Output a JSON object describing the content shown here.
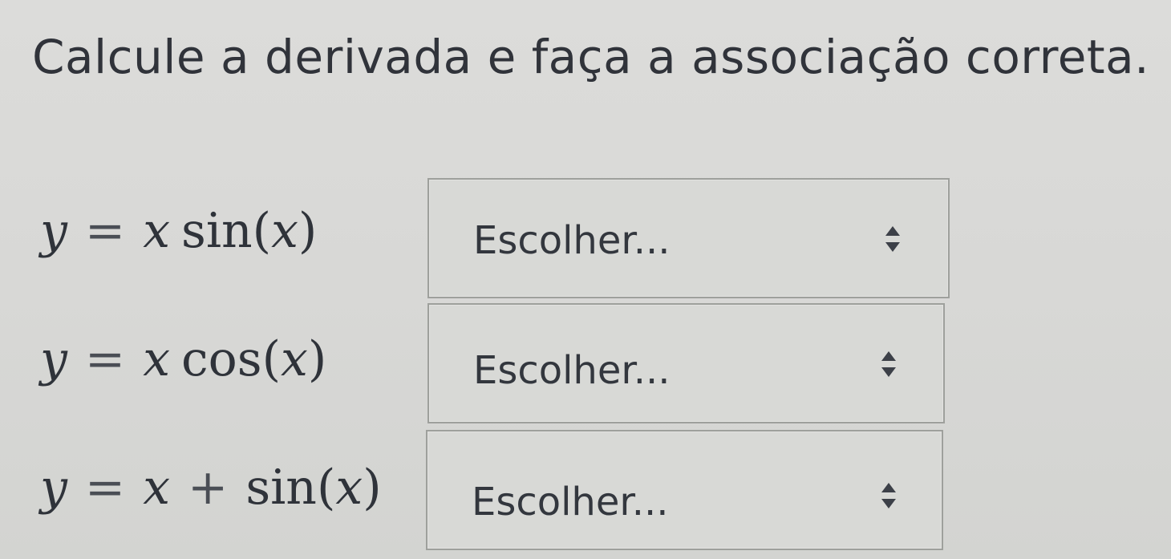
{
  "question": {
    "text": "Calcule a derivada e faça a associação correta."
  },
  "rows": [
    {
      "stem": {
        "lhs": "y",
        "eq": "=",
        "var": "x",
        "func": "sin",
        "arg": "x",
        "op": ""
      },
      "select": {
        "value": "Escolher..."
      }
    },
    {
      "stem": {
        "lhs": "y",
        "eq": "=",
        "var": "x",
        "func": "cos",
        "arg": "x",
        "op": ""
      },
      "select": {
        "value": "Escolher..."
      }
    },
    {
      "stem": {
        "lhs": "y",
        "eq": "=",
        "var": "x",
        "func": "sin",
        "arg": "x",
        "op": "+"
      },
      "select": {
        "value": "Escolher..."
      }
    }
  ],
  "icons": {
    "select_arrows": "select-arrows-icon"
  },
  "colors": {
    "background": "#d8d8d6",
    "text": "#30333a",
    "select_border": "#9ea09c"
  }
}
